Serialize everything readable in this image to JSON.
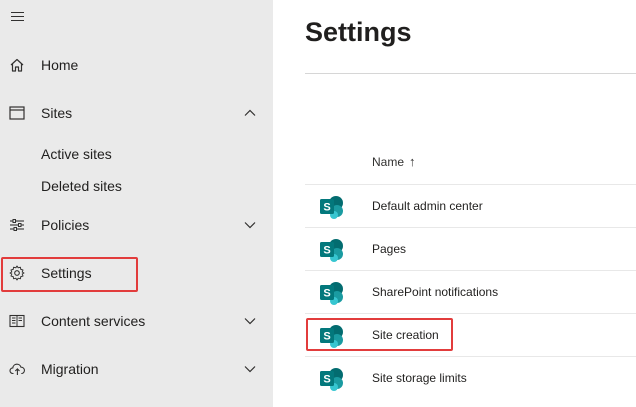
{
  "sidebar": {
    "items": [
      {
        "label": "Home",
        "icon": "home-icon"
      },
      {
        "label": "Sites",
        "icon": "sites-icon"
      },
      {
        "label": "Policies",
        "icon": "policies-icon"
      },
      {
        "label": "Settings",
        "icon": "gear-icon"
      },
      {
        "label": "Content services",
        "icon": "content-services-icon"
      },
      {
        "label": "Migration",
        "icon": "migration-icon"
      }
    ],
    "sites_subitems": [
      "Active sites",
      "Deleted sites"
    ]
  },
  "main": {
    "title": "Settings",
    "column_header": "Name",
    "sort_indicator": "↑",
    "rows": [
      {
        "label": "Default admin center"
      },
      {
        "label": "Pages"
      },
      {
        "label": "SharePoint notifications"
      },
      {
        "label": "Site creation"
      },
      {
        "label": "Site storage limits"
      }
    ]
  },
  "colors": {
    "sidebar_bg": "#eaeaea",
    "highlight": "#e23c3c",
    "sharepoint_teal": "#038387"
  }
}
